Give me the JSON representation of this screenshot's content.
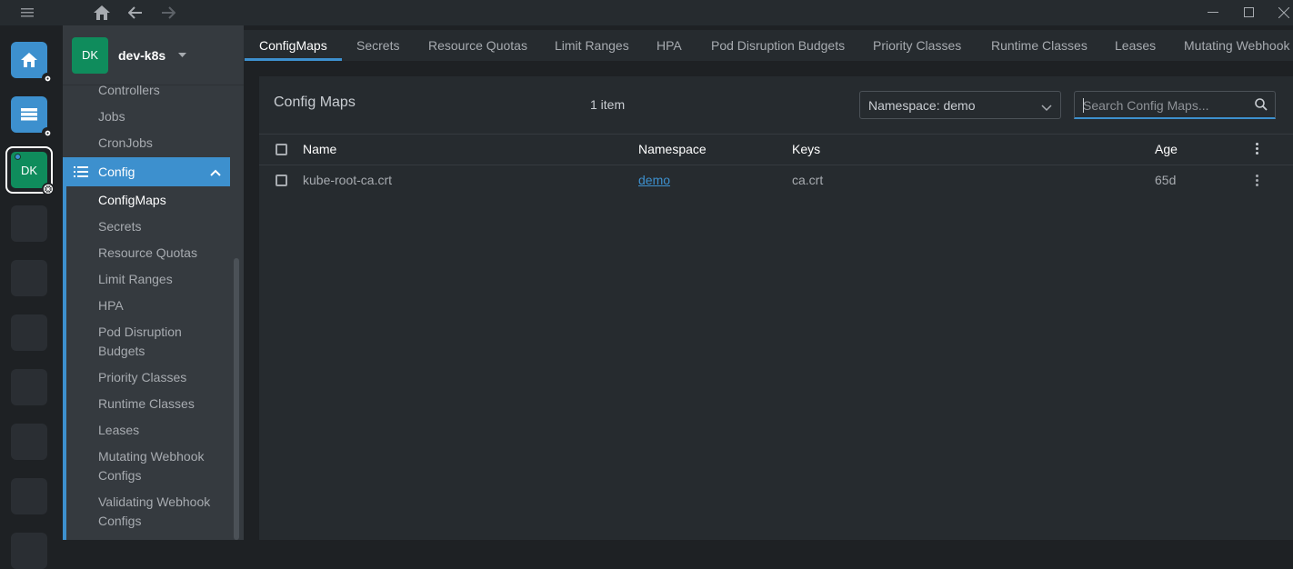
{
  "cluster": {
    "initials": "DK",
    "name": "dev-k8s"
  },
  "hotbar": {
    "active_initials": "DK"
  },
  "sidebar": {
    "items_above": [
      "Controllers",
      "Jobs",
      "CronJobs"
    ],
    "section": "Config",
    "items": [
      {
        "label": "ConfigMaps",
        "active": true
      },
      {
        "label": "Secrets"
      },
      {
        "label": "Resource Quotas"
      },
      {
        "label": "Limit Ranges"
      },
      {
        "label": "HPA"
      },
      {
        "label": "Pod Disruption Budgets"
      },
      {
        "label": "Priority Classes"
      },
      {
        "label": "Runtime Classes"
      },
      {
        "label": "Leases"
      },
      {
        "label": "Mutating Webhook Configs"
      },
      {
        "label": "Validating Webhook Configs"
      }
    ]
  },
  "tabs": [
    "ConfigMaps",
    "Secrets",
    "Resource Quotas",
    "Limit Ranges",
    "HPA",
    "Pod Disruption Budgets",
    "Priority Classes",
    "Runtime Classes",
    "Leases",
    "Mutating Webhook"
  ],
  "panel": {
    "title": "Config Maps",
    "count": "1 item",
    "namespace_select": "Namespace: demo",
    "search_placeholder": "Search Config Maps..."
  },
  "table": {
    "columns": [
      "Name",
      "Namespace",
      "Keys",
      "Age"
    ],
    "rows": [
      {
        "name": "kube-root-ca.crt",
        "namespace": "demo",
        "keys": "ca.crt",
        "age": "65d"
      }
    ]
  },
  "colors": {
    "accent": "#3d90ce",
    "cluster": "#0f8c5c"
  }
}
